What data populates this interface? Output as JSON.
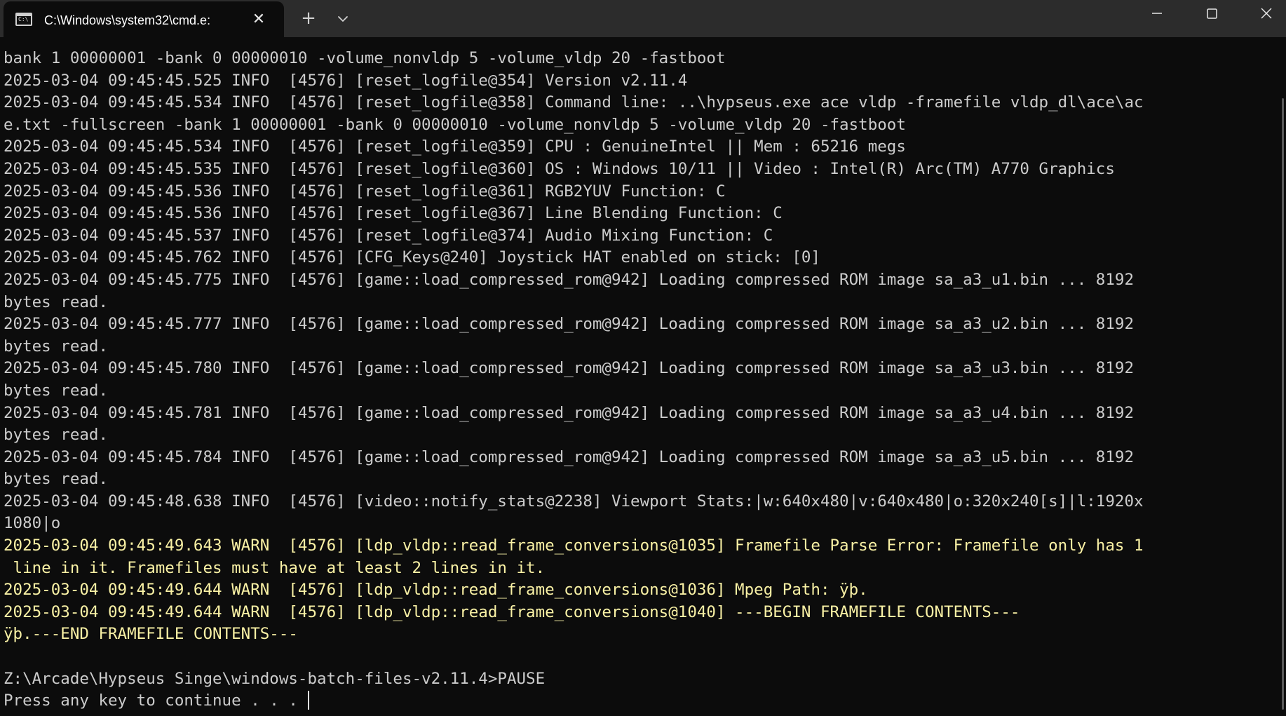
{
  "window": {
    "tab_title": "C:\\Windows\\system32\\cmd.e:",
    "tab_icon_text": "C:\\",
    "tab_close_glyph": "✕",
    "new_tab_glyph": "+",
    "icons": {
      "tab": "cmd-icon",
      "close_tab": "close-icon",
      "new_tab": "plus-icon",
      "dropdown": "chevron-down-icon",
      "minimize": "minimize-icon",
      "maximize": "maximize-icon",
      "close_window": "close-icon"
    }
  },
  "colors": {
    "background": "#0c0c0c",
    "titlebar": "#2c2c2c",
    "text": "#cccccc",
    "warn_text": "#f9f1a5"
  },
  "console": {
    "lines": [
      {
        "text": "bank 1 00000001 -bank 0 00000010 -volume_nonvldp 5 -volume_vldp 20 -fastboot",
        "level": "normal"
      },
      {
        "text": "2025-03-04 09:45:45.525 INFO  [4576] [reset_logfile@354] Version v2.11.4",
        "level": "normal"
      },
      {
        "text": "2025-03-04 09:45:45.534 INFO  [4576] [reset_logfile@358] Command line: ..\\hypseus.exe ace vldp -framefile vldp_dl\\ace\\ac",
        "level": "normal"
      },
      {
        "text": "e.txt -fullscreen -bank 1 00000001 -bank 0 00000010 -volume_nonvldp 5 -volume_vldp 20 -fastboot",
        "level": "normal"
      },
      {
        "text": "2025-03-04 09:45:45.534 INFO  [4576] [reset_logfile@359] CPU : GenuineIntel || Mem : 65216 megs",
        "level": "normal"
      },
      {
        "text": "2025-03-04 09:45:45.535 INFO  [4576] [reset_logfile@360] OS : Windows 10/11 || Video : Intel(R) Arc(TM) A770 Graphics",
        "level": "normal"
      },
      {
        "text": "2025-03-04 09:45:45.536 INFO  [4576] [reset_logfile@361] RGB2YUV Function: C",
        "level": "normal"
      },
      {
        "text": "2025-03-04 09:45:45.536 INFO  [4576] [reset_logfile@367] Line Blending Function: C",
        "level": "normal"
      },
      {
        "text": "2025-03-04 09:45:45.537 INFO  [4576] [reset_logfile@374] Audio Mixing Function: C",
        "level": "normal"
      },
      {
        "text": "2025-03-04 09:45:45.762 INFO  [4576] [CFG_Keys@240] Joystick HAT enabled on stick: [0]",
        "level": "normal"
      },
      {
        "text": "2025-03-04 09:45:45.775 INFO  [4576] [game::load_compressed_rom@942] Loading compressed ROM image sa_a3_u1.bin ... 8192",
        "level": "normal"
      },
      {
        "text": "bytes read.",
        "level": "normal"
      },
      {
        "text": "2025-03-04 09:45:45.777 INFO  [4576] [game::load_compressed_rom@942] Loading compressed ROM image sa_a3_u2.bin ... 8192",
        "level": "normal"
      },
      {
        "text": "bytes read.",
        "level": "normal"
      },
      {
        "text": "2025-03-04 09:45:45.780 INFO  [4576] [game::load_compressed_rom@942] Loading compressed ROM image sa_a3_u3.bin ... 8192",
        "level": "normal"
      },
      {
        "text": "bytes read.",
        "level": "normal"
      },
      {
        "text": "2025-03-04 09:45:45.781 INFO  [4576] [game::load_compressed_rom@942] Loading compressed ROM image sa_a3_u4.bin ... 8192",
        "level": "normal"
      },
      {
        "text": "bytes read.",
        "level": "normal"
      },
      {
        "text": "2025-03-04 09:45:45.784 INFO  [4576] [game::load_compressed_rom@942] Loading compressed ROM image sa_a3_u5.bin ... 8192",
        "level": "normal"
      },
      {
        "text": "bytes read.",
        "level": "normal"
      },
      {
        "text": "2025-03-04 09:45:48.638 INFO  [4576] [video::notify_stats@2238] Viewport Stats:|w:640x480|v:640x480|o:320x240[s]|l:1920x",
        "level": "normal"
      },
      {
        "text": "1080|o",
        "level": "normal"
      },
      {
        "text": "2025-03-04 09:45:49.643 WARN  [4576] [ldp_vldp::read_frame_conversions@1035] Framefile Parse Error: Framefile only has 1",
        "level": "warn"
      },
      {
        "text": " line in it. Framefiles must have at least 2 lines in it.",
        "level": "warn"
      },
      {
        "text": "2025-03-04 09:45:49.644 WARN  [4576] [ldp_vldp::read_frame_conversions@1036] Mpeg Path: ÿþ.",
        "level": "warn"
      },
      {
        "text": "2025-03-04 09:45:49.644 WARN  [4576] [ldp_vldp::read_frame_conversions@1040] ---BEGIN FRAMEFILE CONTENTS---",
        "level": "warn"
      },
      {
        "text": "ÿþ.---END FRAMEFILE CONTENTS---",
        "level": "warn"
      },
      {
        "text": "",
        "level": "normal"
      },
      {
        "text": "Z:\\Arcade\\Hypseus Singe\\windows-batch-files-v2.11.4>PAUSE",
        "level": "normal"
      },
      {
        "text": "Press any key to continue . . . ",
        "level": "prompt"
      }
    ]
  }
}
